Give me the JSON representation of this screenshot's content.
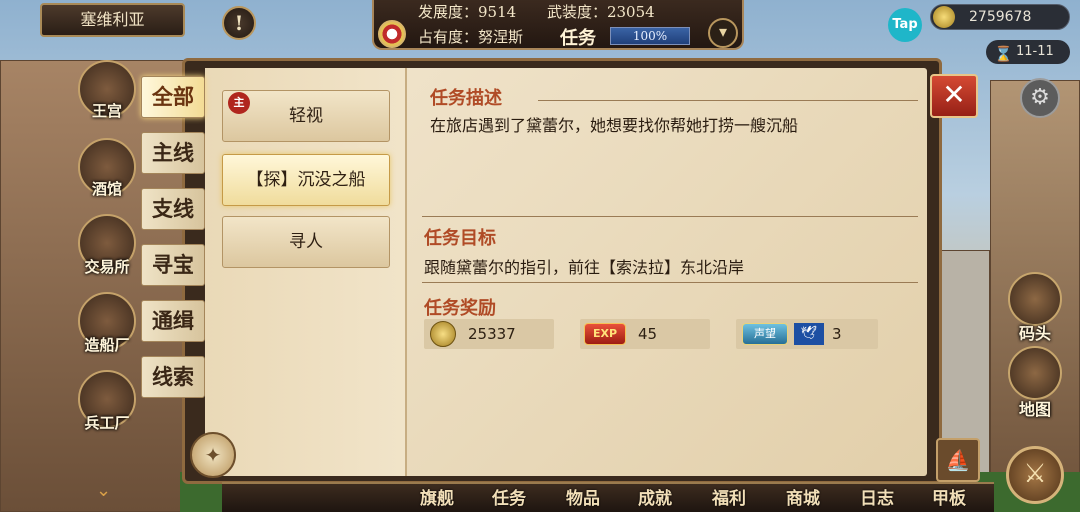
{
  "hud": {
    "city_name": "塞维利亚",
    "alert_symbol": "!",
    "development": "发展度：9514",
    "armament": "武装度：23054",
    "occupation": "占有度：努涅斯",
    "task_label": "任务",
    "progress_text": "100%",
    "progress_fraction": 1.0,
    "tap_label": "Tap",
    "gold": "2759678",
    "date": "11-11"
  },
  "buildings": [
    {
      "label": "王宫"
    },
    {
      "label": "酒馆"
    },
    {
      "label": "交易所"
    },
    {
      "label": "造船厂"
    },
    {
      "label": "兵工厂"
    }
  ],
  "categories": [
    {
      "label": "全部",
      "active": true
    },
    {
      "label": "主线"
    },
    {
      "label": "支线"
    },
    {
      "label": "寻宝"
    },
    {
      "label": "通缉"
    },
    {
      "label": "线索"
    }
  ],
  "quests": [
    {
      "label": "轻视",
      "badge": "主"
    },
    {
      "label": "【探】沉没之船",
      "selected": true
    },
    {
      "label": "寻人"
    }
  ],
  "detail": {
    "desc_title": "任务描述",
    "desc_text": "在旅店遇到了黛蕾尔，她想要找你帮她打捞一艘沉船",
    "goal_title": "任务目标",
    "goal_text": "跟随黛蕾尔的指引，前往【索法拉】东北沿岸",
    "reward_title": "任务奖励",
    "rewards": {
      "gold": "25337",
      "exp_icon_text": "EXP",
      "exp": "45",
      "rep_icon_text": "声望",
      "rep": "3"
    }
  },
  "close_symbol": "✕",
  "side": [
    {
      "label": "码头"
    },
    {
      "label": "地图"
    }
  ],
  "bottom_nav": [
    "旗舰",
    "任务",
    "物品",
    "成就",
    "福利",
    "商城",
    "日志",
    "甲板"
  ]
}
